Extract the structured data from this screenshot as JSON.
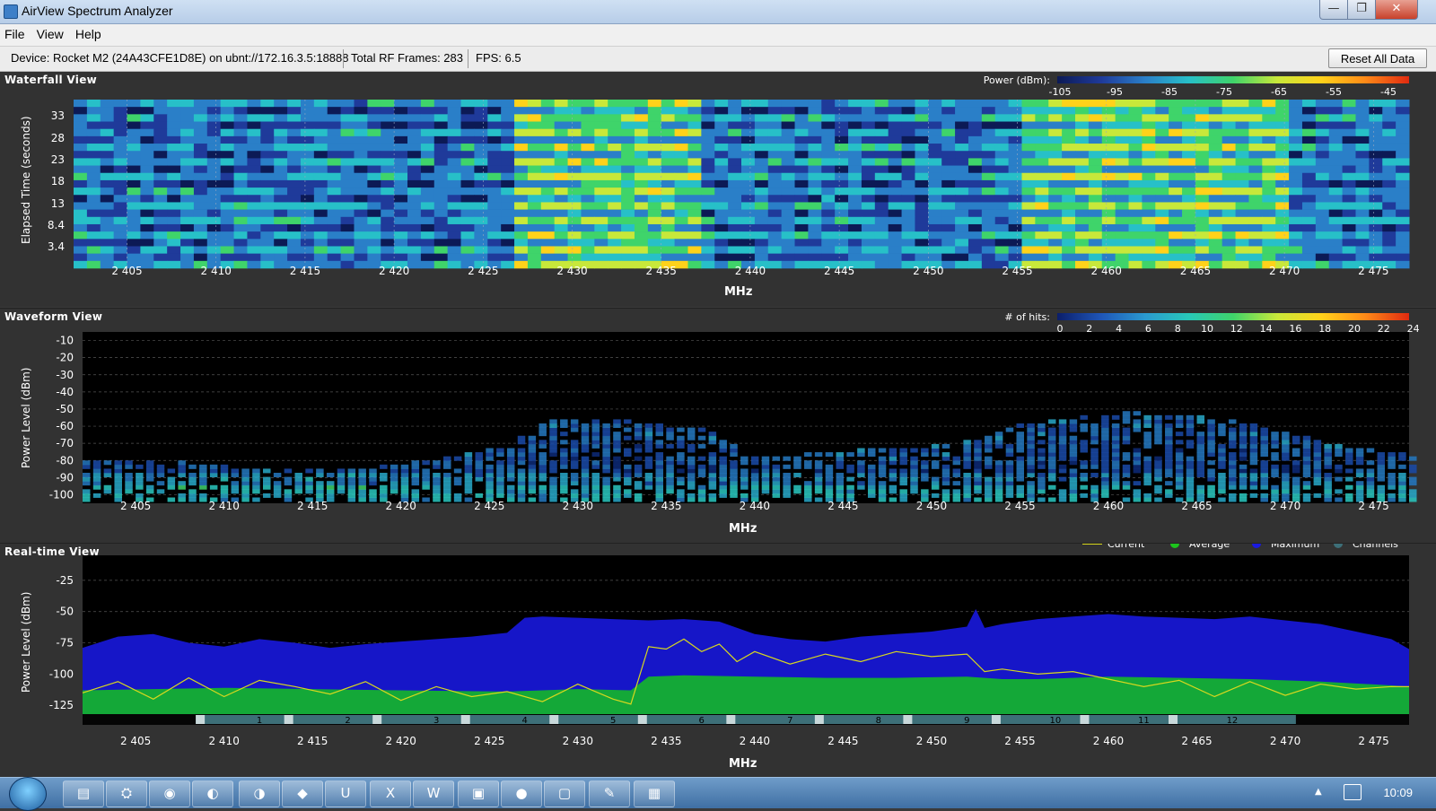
{
  "window": {
    "title": "AirView Spectrum Analyzer",
    "minimize_glyph": "—",
    "maximize_glyph": "❐",
    "close_glyph": "✕"
  },
  "menu": {
    "file": "File",
    "view": "View",
    "help": "Help"
  },
  "status": {
    "device": "Device: Rocket M2 (24A43CFE1D8E) on ubnt://172.16.3.5:18888",
    "frames": "Total RF Frames: 283",
    "fps": "FPS: 6.5",
    "reset_label": "Reset All Data"
  },
  "waterfall": {
    "title": "Waterfall View",
    "legend_label": "Power (dBm):",
    "legend_ticks": [
      "-105",
      "-95",
      "-85",
      "-75",
      "-65",
      "-55",
      "-45"
    ],
    "legend_colors": [
      "#0c1a55",
      "#1f3a9a",
      "#2a7fc8",
      "#27c0c8",
      "#3fd46a",
      "#c8e83a",
      "#ffd21a",
      "#ff8a18",
      "#e02a10"
    ],
    "y_label": "Elapsed Time (seconds)",
    "y_ticks": [
      "33",
      "28",
      "23",
      "18",
      "13",
      "8.4",
      "3.4"
    ],
    "x_label": "MHz"
  },
  "waveform": {
    "title": "Waveform View",
    "legend_label": "# of hits:",
    "legend_ticks": [
      "0",
      "2",
      "4",
      "6",
      "8",
      "10",
      "12",
      "14",
      "16",
      "18",
      "20",
      "22",
      "24"
    ],
    "legend_colors": [
      "#0b1e6a",
      "#1f56b8",
      "#2a9ad0",
      "#28c8b8",
      "#3fd46a",
      "#c8e83a",
      "#ffd21a",
      "#ff8a18",
      "#e02a10"
    ],
    "y_label": "Power Level (dBm)",
    "y_ticks": [
      "-10",
      "-20",
      "-30",
      "-40",
      "-50",
      "-60",
      "-70",
      "-80",
      "-90",
      "-100"
    ],
    "x_label": "MHz"
  },
  "realtime": {
    "title": "Real-time View",
    "legend": [
      {
        "name": "Current",
        "color": "#d8d81e"
      },
      {
        "name": "Average",
        "color": "#1cc41c"
      },
      {
        "name": "Maximum",
        "color": "#1a1ae0"
      },
      {
        "name": "Channels",
        "color": "#3d6f78"
      }
    ],
    "y_label": "Power Level (dBm)",
    "y_ticks": [
      "-25",
      "-50",
      "-75",
      "-100",
      "-125"
    ],
    "x_label": "MHz",
    "channels": [
      "1",
      "2",
      "3",
      "4",
      "5",
      "6",
      "7",
      "8",
      "9",
      "10",
      "11",
      "12"
    ]
  },
  "x_ticks": [
    "2 405",
    "2 410",
    "2 415",
    "2 420",
    "2 425",
    "2 430",
    "2 435",
    "2 440",
    "2 445",
    "2 450",
    "2 455",
    "2 460",
    "2 465",
    "2 470",
    "2 475"
  ],
  "chart_data": [
    {
      "type": "heatmap",
      "title": "Waterfall View",
      "xlabel": "MHz",
      "ylabel": "Elapsed Time (seconds)",
      "xlim": [
        2402,
        2477
      ],
      "x_ticks": [
        2405,
        2410,
        2415,
        2420,
        2425,
        2430,
        2435,
        2440,
        2445,
        2450,
        2455,
        2460,
        2465,
        2470,
        2475
      ],
      "y_ticks": [
        33,
        28,
        23,
        18,
        13,
        8.4,
        3.4
      ],
      "color_scale_label": "Power (dBm):",
      "color_scale_range": [
        -105,
        -45
      ],
      "hotspot_bands_mhz": [
        [
          2426.5,
          2437
        ],
        [
          2455,
          2470
        ]
      ]
    },
    {
      "type": "heatmap",
      "title": "Waveform View",
      "xlabel": "MHz",
      "ylabel": "Power Level (dBm)",
      "xlim": [
        2402,
        2477
      ],
      "ylim": [
        -105,
        -5
      ],
      "x_ticks": [
        2405,
        2410,
        2415,
        2420,
        2425,
        2430,
        2435,
        2440,
        2445,
        2450,
        2455,
        2460,
        2465,
        2470,
        2475
      ],
      "y_ticks": [
        -10,
        -20,
        -30,
        -40,
        -50,
        -60,
        -70,
        -80,
        -90,
        -100
      ],
      "color_scale_label": "# of hits:",
      "color_scale_range": [
        0,
        24
      ],
      "envelope": {
        "x": [
          2402,
          2406,
          2410,
          2414,
          2418,
          2422,
          2426,
          2428,
          2431,
          2434,
          2437,
          2440,
          2444,
          2448,
          2452,
          2455,
          2458,
          2461,
          2464,
          2467,
          2470,
          2473,
          2477
        ],
        "top": [
          -82,
          -80,
          -85,
          -86,
          -85,
          -80,
          -72,
          -57,
          -56,
          -60,
          -63,
          -80,
          -76,
          -74,
          -70,
          -60,
          -56,
          -53,
          -55,
          -58,
          -65,
          -72,
          -78
        ]
      }
    },
    {
      "type": "area",
      "title": "Real-time View",
      "xlabel": "MHz",
      "ylabel": "Power Level (dBm)",
      "xlim": [
        2402,
        2477
      ],
      "ylim": [
        -132,
        -5
      ],
      "x_ticks": [
        2405,
        2410,
        2415,
        2420,
        2425,
        2430,
        2435,
        2440,
        2445,
        2450,
        2455,
        2460,
        2465,
        2470,
        2475
      ],
      "y_ticks": [
        -25,
        -50,
        -75,
        -100,
        -125
      ],
      "series": [
        {
          "name": "Maximum",
          "x": [
            2402,
            2404,
            2406,
            2408,
            2410,
            2412,
            2414,
            2416,
            2418,
            2420,
            2422,
            2424,
            2426,
            2427,
            2428,
            2430,
            2432,
            2434,
            2436,
            2438,
            2440,
            2442,
            2444,
            2446,
            2448,
            2450,
            2452,
            2452.5,
            2453,
            2454,
            2456,
            2458,
            2460,
            2462,
            2464,
            2466,
            2468,
            2470,
            2472,
            2474,
            2476,
            2477
          ],
          "y": [
            -79,
            -70,
            -68,
            -75,
            -78,
            -72,
            -75,
            -79,
            -76,
            -74,
            -72,
            -70,
            -67,
            -55,
            -54,
            -55,
            -56,
            -57,
            -56,
            -58,
            -68,
            -72,
            -74,
            -70,
            -68,
            -66,
            -62,
            -48,
            -63,
            -60,
            -56,
            -54,
            -52,
            -54,
            -55,
            -56,
            -54,
            -57,
            -60,
            -66,
            -72,
            -80
          ]
        },
        {
          "name": "Average",
          "x": [
            2402,
            2410,
            2420,
            2426,
            2430,
            2433,
            2434,
            2436,
            2440,
            2444,
            2448,
            2452,
            2454,
            2456,
            2460,
            2464,
            2468,
            2472,
            2476,
            2477
          ],
          "y": [
            -113,
            -111,
            -113,
            -114,
            -112,
            -113,
            -102,
            -101,
            -102,
            -103,
            -103,
            -102,
            -104,
            -104,
            -102,
            -103,
            -104,
            -106,
            -109,
            -110
          ]
        },
        {
          "name": "Current",
          "x": [
            2402,
            2404,
            2406,
            2408,
            2410,
            2412,
            2414,
            2416,
            2418,
            2420,
            2422,
            2424,
            2426,
            2428,
            2430,
            2432,
            2433,
            2434,
            2435,
            2436,
            2437,
            2438,
            2439,
            2440,
            2442,
            2444,
            2446,
            2448,
            2450,
            2452,
            2453,
            2454,
            2456,
            2458,
            2460,
            2462,
            2464,
            2466,
            2468,
            2470,
            2472,
            2474,
            2476,
            2477
          ],
          "y": [
            -115,
            -106,
            -120,
            -103,
            -118,
            -105,
            -110,
            -116,
            -106,
            -121,
            -110,
            -118,
            -114,
            -122,
            -108,
            -120,
            -124,
            -78,
            -80,
            -72,
            -82,
            -76,
            -90,
            -82,
            -92,
            -84,
            -90,
            -82,
            -86,
            -84,
            -98,
            -96,
            -100,
            -98,
            -104,
            -110,
            -105,
            -118,
            -106,
            -117,
            -108,
            -112,
            -110,
            -110
          ]
        }
      ],
      "channels": {
        "labels": [
          "1",
          "2",
          "3",
          "4",
          "5",
          "6",
          "7",
          "8",
          "9",
          "10",
          "11",
          "12"
        ],
        "centers_mhz": [
          2412,
          2417,
          2422,
          2427,
          2432,
          2437,
          2442,
          2447,
          2452,
          2457,
          2462,
          2467
        ]
      }
    }
  ]
}
